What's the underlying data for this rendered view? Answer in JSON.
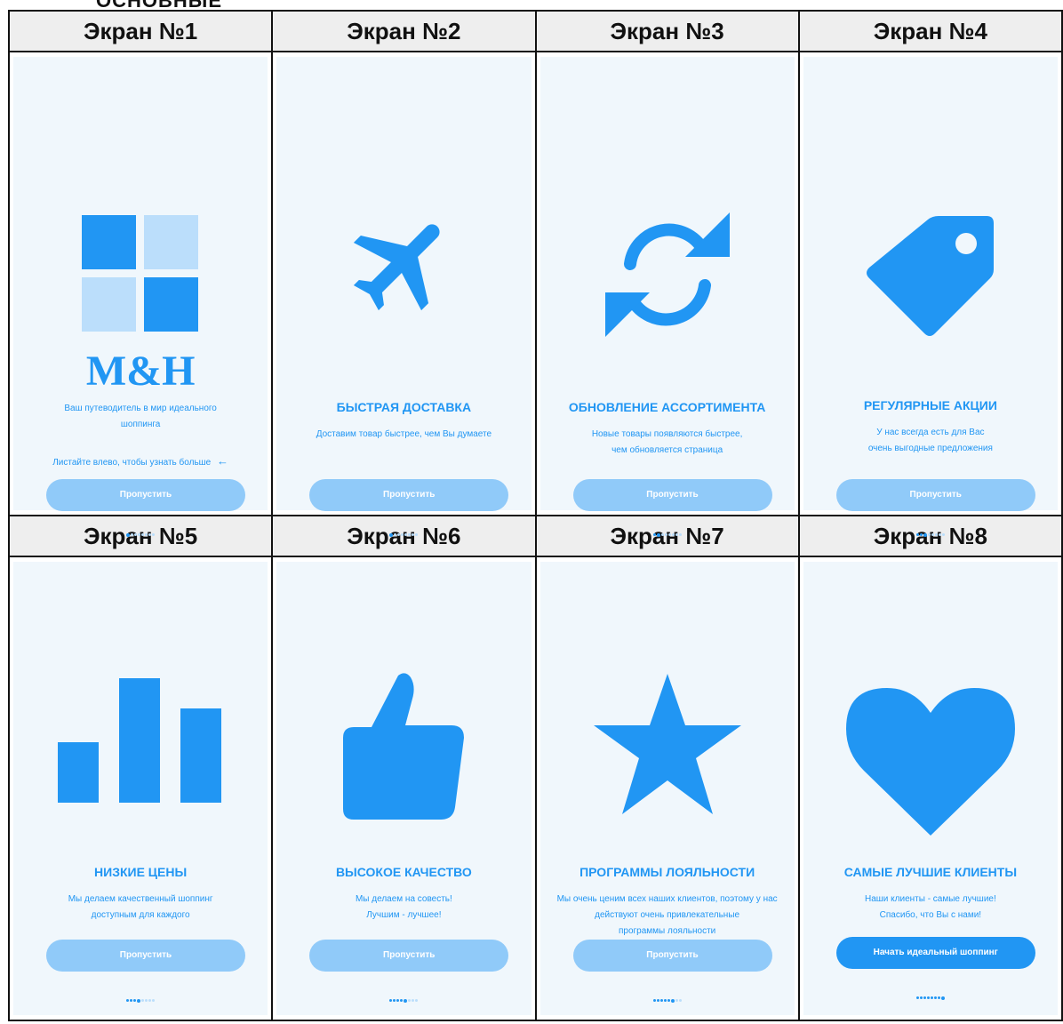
{
  "top_text": "ОСНОВНЫЕ",
  "colors": {
    "accent": "#2196f3",
    "light": "#bbdefb",
    "button": "#90caf9",
    "screen_bg": "#f0f7fc"
  },
  "screens": [
    {
      "header": "Экран №1",
      "icon": "grid-logo-icon",
      "logo": "M&H",
      "desc": [
        "Ваш путеводитель в мир идеального",
        "шоппинга"
      ],
      "swipe": "Листайте влево, чтобы узнать больше",
      "button": "Пропустить",
      "active_dot": 1
    },
    {
      "header": "Экран №2",
      "icon": "airplane-icon",
      "title": "БЫСТРАЯ ДОСТАВКА",
      "desc": [
        "Доставим товар быстрее, чем Вы думаете"
      ],
      "button": "Пропустить",
      "active_dot": 1
    },
    {
      "header": "Экран №3",
      "icon": "refresh-icon",
      "title": "ОБНОВЛЕНИЕ АССОРТИМЕНТА",
      "desc": [
        "Новые товары появляются быстрее,",
        "чем обновляется страница"
      ],
      "button": "Пропустить",
      "active_dot": 2
    },
    {
      "header": "Экран №4",
      "icon": "price-tag-icon",
      "title": "РЕГУЛЯРНЫЕ АКЦИИ",
      "desc": [
        "У нас всегда есть для Вас",
        "очень выгодные предложения"
      ],
      "button": "Пропустить",
      "active_dot": 3
    },
    {
      "header": "Экран №5",
      "icon": "bar-chart-icon",
      "title": "НИЗКИЕ ЦЕНЫ",
      "desc": [
        "Мы делаем качественный шоппинг",
        "доступным для каждого"
      ],
      "button": "Пропустить",
      "active_dot": 4
    },
    {
      "header": "Экран №6",
      "icon": "thumbs-up-icon",
      "title": "ВЫСОКОЕ КАЧЕСТВО",
      "desc": [
        "Мы делаем на совесть!",
        "Лучшим - лучшее!"
      ],
      "button": "Пропустить",
      "active_dot": 5
    },
    {
      "header": "Экран №7",
      "icon": "star-icon",
      "title": "ПРОГРАММЫ ЛОЯЛЬНОСТИ",
      "desc": [
        "Мы очень ценим всех наших клиентов, поэтому у нас",
        "действуют очень привлекательные",
        "программы лояльности"
      ],
      "button": "Пропустить",
      "active_dot": 6
    },
    {
      "header": "Экран №8",
      "icon": "heart-icon",
      "title": "САМЫЕ ЛУЧШИЕ КЛИЕНТЫ",
      "desc": [
        "Наши клиенты - самые лучшие!",
        "Спасибо, что Вы с нами!"
      ],
      "button": "Начать идеальный шоппинг",
      "active_dot": 8
    }
  ]
}
